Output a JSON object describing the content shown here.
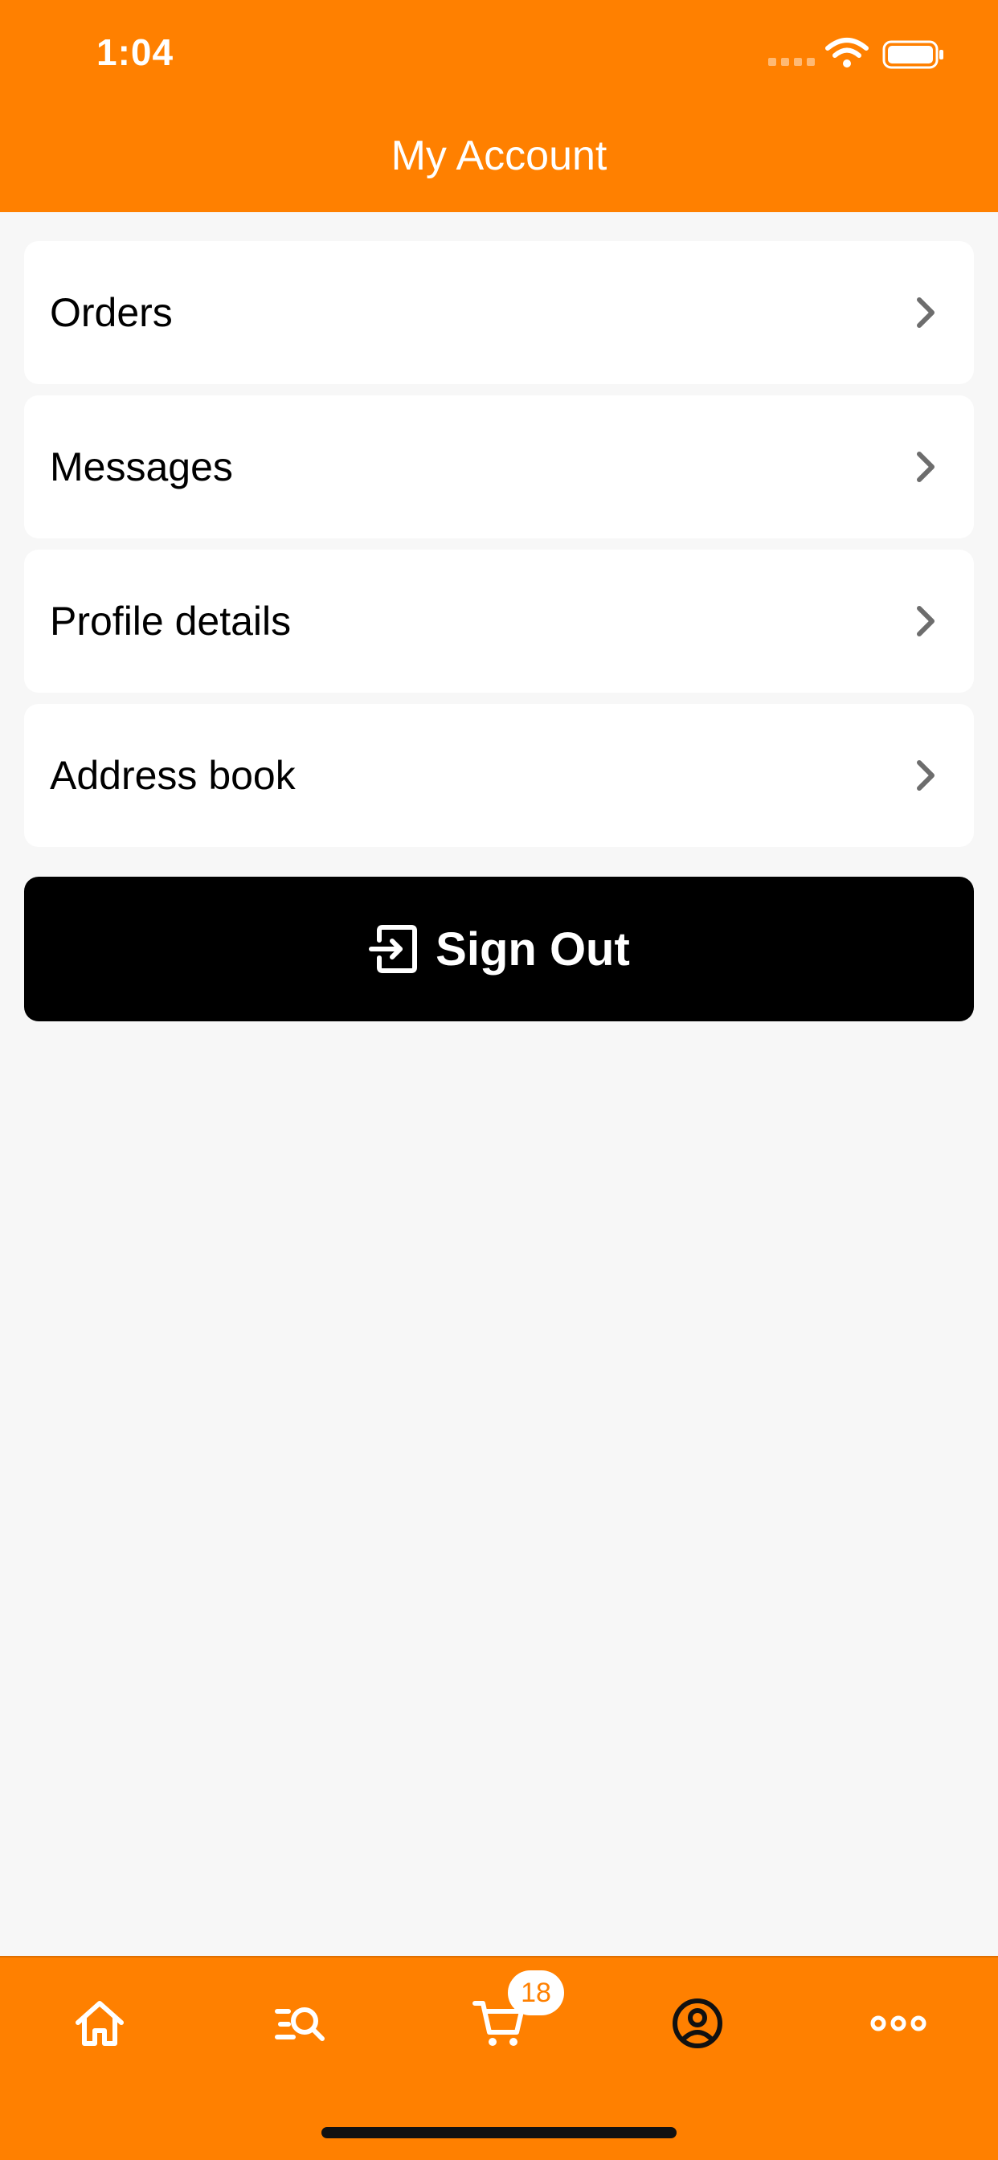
{
  "status": {
    "time": "1:04"
  },
  "header": {
    "title": "My Account"
  },
  "menu": {
    "items": [
      {
        "label": "Orders"
      },
      {
        "label": "Messages"
      },
      {
        "label": "Profile details"
      },
      {
        "label": "Address book"
      }
    ]
  },
  "signout": {
    "label": "Sign Out",
    "icon": "sign-out-icon"
  },
  "tabbar": {
    "tabs": [
      {
        "name": "home",
        "icon": "home-icon"
      },
      {
        "name": "search",
        "icon": "search-list-icon"
      },
      {
        "name": "cart",
        "icon": "cart-icon"
      },
      {
        "name": "account",
        "icon": "account-icon",
        "active": true
      },
      {
        "name": "more",
        "icon": "more-icon"
      }
    ],
    "cart_badge": "18"
  },
  "colors": {
    "accent": "#ff8000",
    "background": "#f7f7f7",
    "button": "#000000"
  }
}
